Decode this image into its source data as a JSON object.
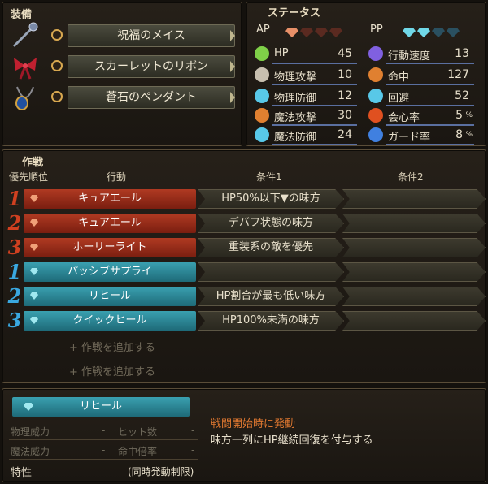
{
  "equipment": {
    "title": "装備",
    "items": [
      {
        "name": "祝福のメイス",
        "icon": "mace-icon"
      },
      {
        "name": "スカーレットのリボン",
        "icon": "ribbon-icon"
      },
      {
        "name": "蒼石のペンダント",
        "icon": "pendant-icon"
      }
    ]
  },
  "status": {
    "title": "ステータス",
    "ap_label": "AP",
    "pp_label": "PP",
    "stats": [
      {
        "label": "HP",
        "value": "45",
        "icon": "heart-icon",
        "color": "#7fd048"
      },
      {
        "label": "物理攻撃",
        "value": "10",
        "icon": "sword-icon",
        "color": "#e8e0cc"
      },
      {
        "label": "物理防御",
        "value": "12",
        "icon": "armor-icon",
        "color": "#58c8e8"
      },
      {
        "label": "魔法攻撃",
        "value": "30",
        "icon": "wand-icon",
        "color": "#e08030"
      },
      {
        "label": "魔法防御",
        "value": "24",
        "icon": "robe-icon",
        "color": "#58c8e8"
      },
      {
        "label": "行動速度",
        "value": "13",
        "icon": "speed-icon",
        "color": "#8060e0"
      },
      {
        "label": "命中",
        "value": "127",
        "icon": "target-icon",
        "color": "#e08030"
      },
      {
        "label": "回避",
        "value": "52",
        "icon": "dodge-icon",
        "color": "#58c8e8"
      },
      {
        "label": "会心率",
        "value": "5",
        "unit": "%",
        "icon": "crit-icon",
        "color": "#e05020"
      },
      {
        "label": "ガード率",
        "value": "8",
        "unit": "%",
        "icon": "shield-icon",
        "color": "#4080e0"
      }
    ]
  },
  "tactics": {
    "title": "作戦",
    "headers": {
      "priority": "優先順位",
      "action": "行動",
      "cond1": "条件1",
      "cond2": "条件2"
    },
    "rows": [
      {
        "num": "1",
        "type": "red",
        "action": "キュアエール",
        "cond1": "HP50%以下▼の味方",
        "cond2": ""
      },
      {
        "num": "2",
        "type": "red",
        "action": "キュアエール",
        "cond1": "デバフ状態の味方",
        "cond2": ""
      },
      {
        "num": "3",
        "type": "red",
        "action": "ホーリーライト",
        "cond1": "重装系の敵を優先",
        "cond2": ""
      },
      {
        "num": "1",
        "type": "teal",
        "action": "パッシブサプライ",
        "cond1": "",
        "cond2": ""
      },
      {
        "num": "2",
        "type": "teal",
        "action": "リヒール",
        "cond1": "HP割合が最も低い味方",
        "cond2": ""
      },
      {
        "num": "3",
        "type": "teal",
        "action": "クイックヒール",
        "cond1": "HP100%未満の味方",
        "cond2": ""
      }
    ],
    "add_label": "+ 作戦を追加する"
  },
  "detail": {
    "skill_name": "リヒール",
    "stats": [
      {
        "label": "物理威力",
        "value": "-"
      },
      {
        "label": "ヒット数",
        "value": "-"
      },
      {
        "label": "魔法威力",
        "value": "-"
      },
      {
        "label": "命中倍率",
        "value": "-"
      }
    ],
    "trait_label": "特性",
    "trait_value": "(同時発動制限)",
    "timing": "戦闘開始時に発動",
    "description": "味方一列にHP継続回復を付与する"
  }
}
